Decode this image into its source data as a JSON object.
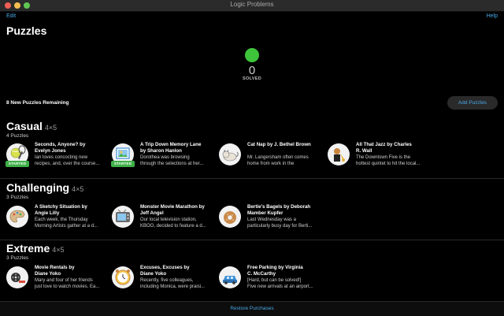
{
  "window": {
    "title": "Logic Problems"
  },
  "toolbar": {
    "edit_label": "Edit",
    "help_label": "Help"
  },
  "header": {
    "title": "Puzzles"
  },
  "stats": {
    "solved_count": "0",
    "solved_label": "SOLVED",
    "accent": "#3ec43a"
  },
  "remaining": {
    "text": "8 New Puzzles Remaining",
    "add_label": "Add Puzzles"
  },
  "sections": [
    {
      "name": "Casual",
      "size": "4×5",
      "count": "4 Puzzles",
      "items": [
        {
          "title": "Seconds, Anyone? by\nEvelyn Jones",
          "desc": "Ian loves concocting new\nrecipes, and, over the course...",
          "badge": "STARTED",
          "icon": "tennis-icon"
        },
        {
          "title": "A Trip Down Memory Lane\nby Sharon Hanlon",
          "desc": "Dorothea was browsing\nthrough the selections at her...",
          "badge": "STARTED",
          "icon": "photo-frame-icon"
        },
        {
          "title": "Cat Nap by J. Bethel Brown",
          "desc": "Mr. Langersham often comes\nhome from work in the\nafternoons to find his five cat...",
          "icon": "cat-icon"
        },
        {
          "title": "All That Jazz by Charles\nR. Wall",
          "desc": "The Downtown Five is the\nhottest quintet to hit the local...",
          "icon": "jazz-icon"
        }
      ]
    },
    {
      "name": "Challenging",
      "size": "4×5",
      "count": "3 Puzzles",
      "items": [
        {
          "title": "A Sketchy Situation by\nAngie Lilly",
          "desc": "Each week, the Thursday\nMorning Artists gather at a d...",
          "icon": "palette-icon"
        },
        {
          "title": "Monster Movie Marathon by\nJeff Angel",
          "desc": "Our local television station,\nKBOO, decided to feature a d...",
          "icon": "tv-icon"
        },
        {
          "title": "Bertie's Bagels by Deborah\nMamber Kupfer",
          "desc": "Last Wednesday was a\nparticularly busy day for Berti...",
          "icon": "bagel-icon"
        }
      ]
    },
    {
      "name": "Extreme",
      "size": "4×5",
      "count": "3 Puzzles",
      "items": [
        {
          "title": "Movie Rentals by\nDiane Yoko",
          "desc": "Mary and four of her friends\njust love to watch movies. Ea...",
          "icon": "film-icon"
        },
        {
          "title": "Excuses, Excuses by\nDiane Yoko",
          "desc": "Recently, five colleagues,\nincluding Monica, were praisi...",
          "icon": "clock-icon"
        },
        {
          "title": "Free Parking by Virginia\nC. McCarthy",
          "desc": "[Hard, but can be solved!]\nFive new arrivals at an airport...",
          "icon": "car-icon"
        }
      ]
    }
  ],
  "footer": {
    "restore_label": "Restore Purchases"
  }
}
